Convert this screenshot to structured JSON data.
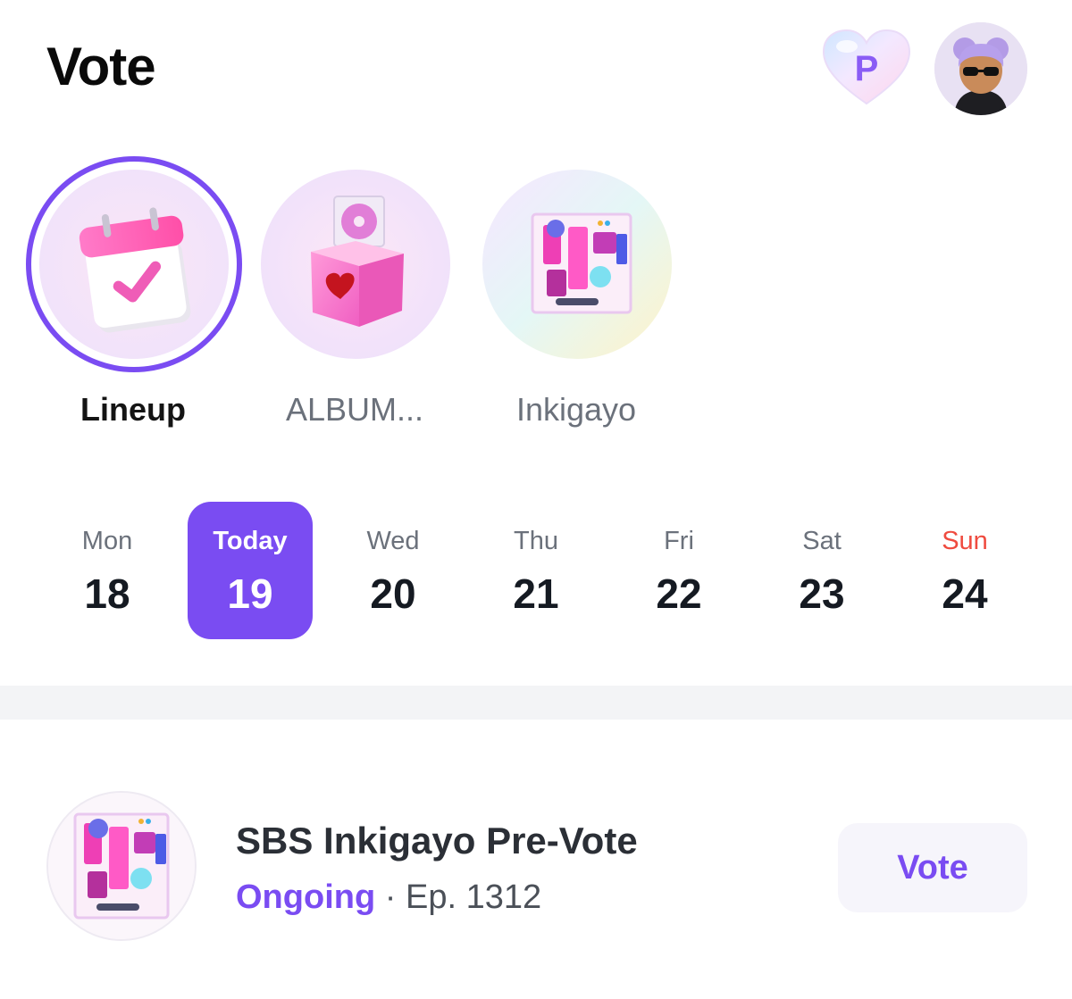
{
  "header": {
    "title": "Vote",
    "heart_letter": "P",
    "heart_icon": "heart-points-icon",
    "avatar_icon": "avatar-sunglasses-icon"
  },
  "categories": [
    {
      "label": "Lineup",
      "icon": "calendar-check-icon",
      "active": true
    },
    {
      "label": "ALBUM...",
      "icon": "ballot-box-heart-icon",
      "active": false
    },
    {
      "label": "Inkigayo",
      "icon": "inkigayo-logo-icon",
      "active": false
    }
  ],
  "week": [
    {
      "name": "Mon",
      "num": "18"
    },
    {
      "name": "Today",
      "num": "19"
    },
    {
      "name": "Wed",
      "num": "20"
    },
    {
      "name": "Thu",
      "num": "21"
    },
    {
      "name": "Fri",
      "num": "22"
    },
    {
      "name": "Sat",
      "num": "23"
    },
    {
      "name": "Sun",
      "num": "24"
    }
  ],
  "vote_item": {
    "title": "SBS Inkigayo Pre-Vote",
    "status": "Ongoing",
    "separator": " · ",
    "episode": "Ep. 1312",
    "button_label": "Vote"
  },
  "colors": {
    "accent": "#7a4cf2",
    "sunday": "#ef4b3f",
    "muted_text": "#6b717b",
    "divider": "#f3f4f6"
  }
}
